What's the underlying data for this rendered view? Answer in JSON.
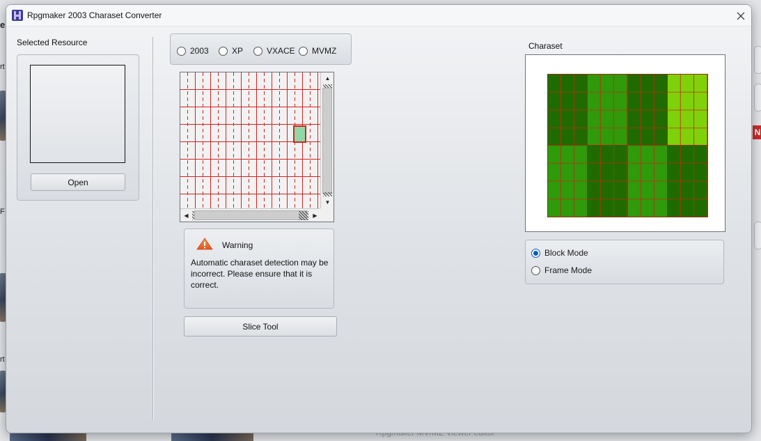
{
  "window": {
    "title": "Rpgmaker 2003 Charaset Converter"
  },
  "background": {
    "fragment_top": "er",
    "fragment_mid": "rt",
    "fragment_low": "rt",
    "fragment_f": "F",
    "badge": "N",
    "bottom_text": "Rpgmaker MV/MZ Viewer editor"
  },
  "left_panel": {
    "group_label": "Selected Resource",
    "open_button": "Open"
  },
  "format_selector": {
    "options": [
      {
        "label": "2003",
        "checked": false
      },
      {
        "label": "XP",
        "checked": false
      },
      {
        "label": "VXACE",
        "checked": false
      },
      {
        "label": "MVMZ",
        "checked": false
      }
    ]
  },
  "slicer": {
    "selected_cell_color": "#8fd9a8",
    "grid_line_color": "#d42222"
  },
  "warning": {
    "title": "Warning",
    "message": "Automatic charaset detection may be incorrect. Please ensure that it is correct."
  },
  "slice_tool_button": "Slice Tool",
  "charset": {
    "label": "Charaset",
    "blocks": [
      {
        "color": "#1f6b00"
      },
      {
        "color": "#2f9a0a"
      },
      {
        "color": "#1f6b00"
      },
      {
        "color": "#7fd10a"
      },
      {
        "color": "#2f9a0a"
      },
      {
        "color": "#1f6b00"
      },
      {
        "color": "#2f9a0a"
      },
      {
        "color": "#1f6b00"
      }
    ]
  },
  "mode": {
    "options": [
      {
        "label": "Block Mode",
        "checked": true
      },
      {
        "label": "Frame Mode",
        "checked": false
      }
    ]
  }
}
